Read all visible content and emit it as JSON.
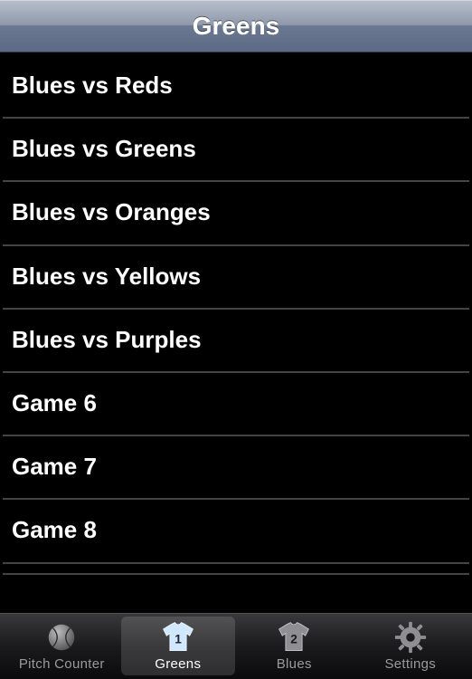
{
  "header": {
    "title": "Greens"
  },
  "games": [
    {
      "label": "Blues vs Reds"
    },
    {
      "label": "Blues vs Greens"
    },
    {
      "label": "Blues vs Oranges"
    },
    {
      "label": "Blues vs Yellows"
    },
    {
      "label": "Blues vs Purples"
    },
    {
      "label": "Game 6"
    },
    {
      "label": "Game 7"
    },
    {
      "label": "Game 8"
    }
  ],
  "tabs": {
    "pitch": {
      "label": "Pitch Counter"
    },
    "greens": {
      "label": "Greens",
      "number": "1"
    },
    "blues": {
      "label": "Blues",
      "number": "2"
    },
    "settings": {
      "label": "Settings"
    }
  }
}
